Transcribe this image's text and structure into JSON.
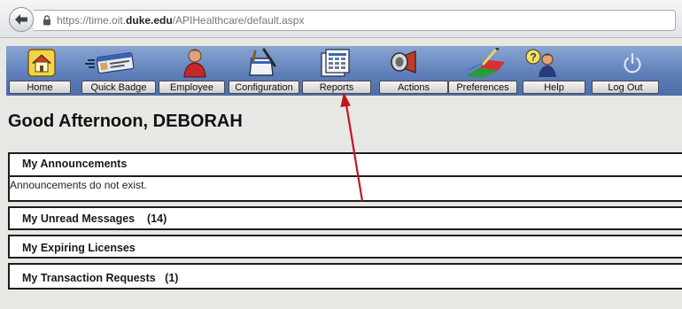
{
  "browser": {
    "url_prefix": "https://time.oit.",
    "url_domain": "duke.edu",
    "url_path": "/APIHealthcare/default.aspx"
  },
  "nav": {
    "items": [
      {
        "label": "Home",
        "icon": "house-icon"
      },
      {
        "label": "Quick Badge",
        "icon": "badge-card-icon"
      },
      {
        "label": "Employee",
        "icon": "person-icon"
      },
      {
        "label": "Configuration",
        "icon": "toolbox-icon"
      },
      {
        "label": "Reports",
        "icon": "report-sheet-icon"
      },
      {
        "label": "Actions",
        "icon": "megaphone-icon"
      },
      {
        "label": "Preferences",
        "icon": "paint-tools-icon"
      },
      {
        "label": "Help",
        "icon": "help-people-icon"
      },
      {
        "label": "Log Out",
        "icon": "power-icon"
      }
    ]
  },
  "greeting": "Good Afternoon, DEBORAH",
  "sections": {
    "announcements": {
      "title": "My Announcements",
      "body": "Announcements do not exist."
    },
    "unread_messages": {
      "title": "My Unread Messages",
      "count": "(14)"
    },
    "expiring_licenses": {
      "title": "My Expiring Licenses"
    },
    "transaction_requests": {
      "title": "My Transaction Requests",
      "count": "(1)"
    }
  },
  "colors": {
    "toolbar": "#5e7fb9",
    "annotation_arrow": "#c0161f"
  }
}
